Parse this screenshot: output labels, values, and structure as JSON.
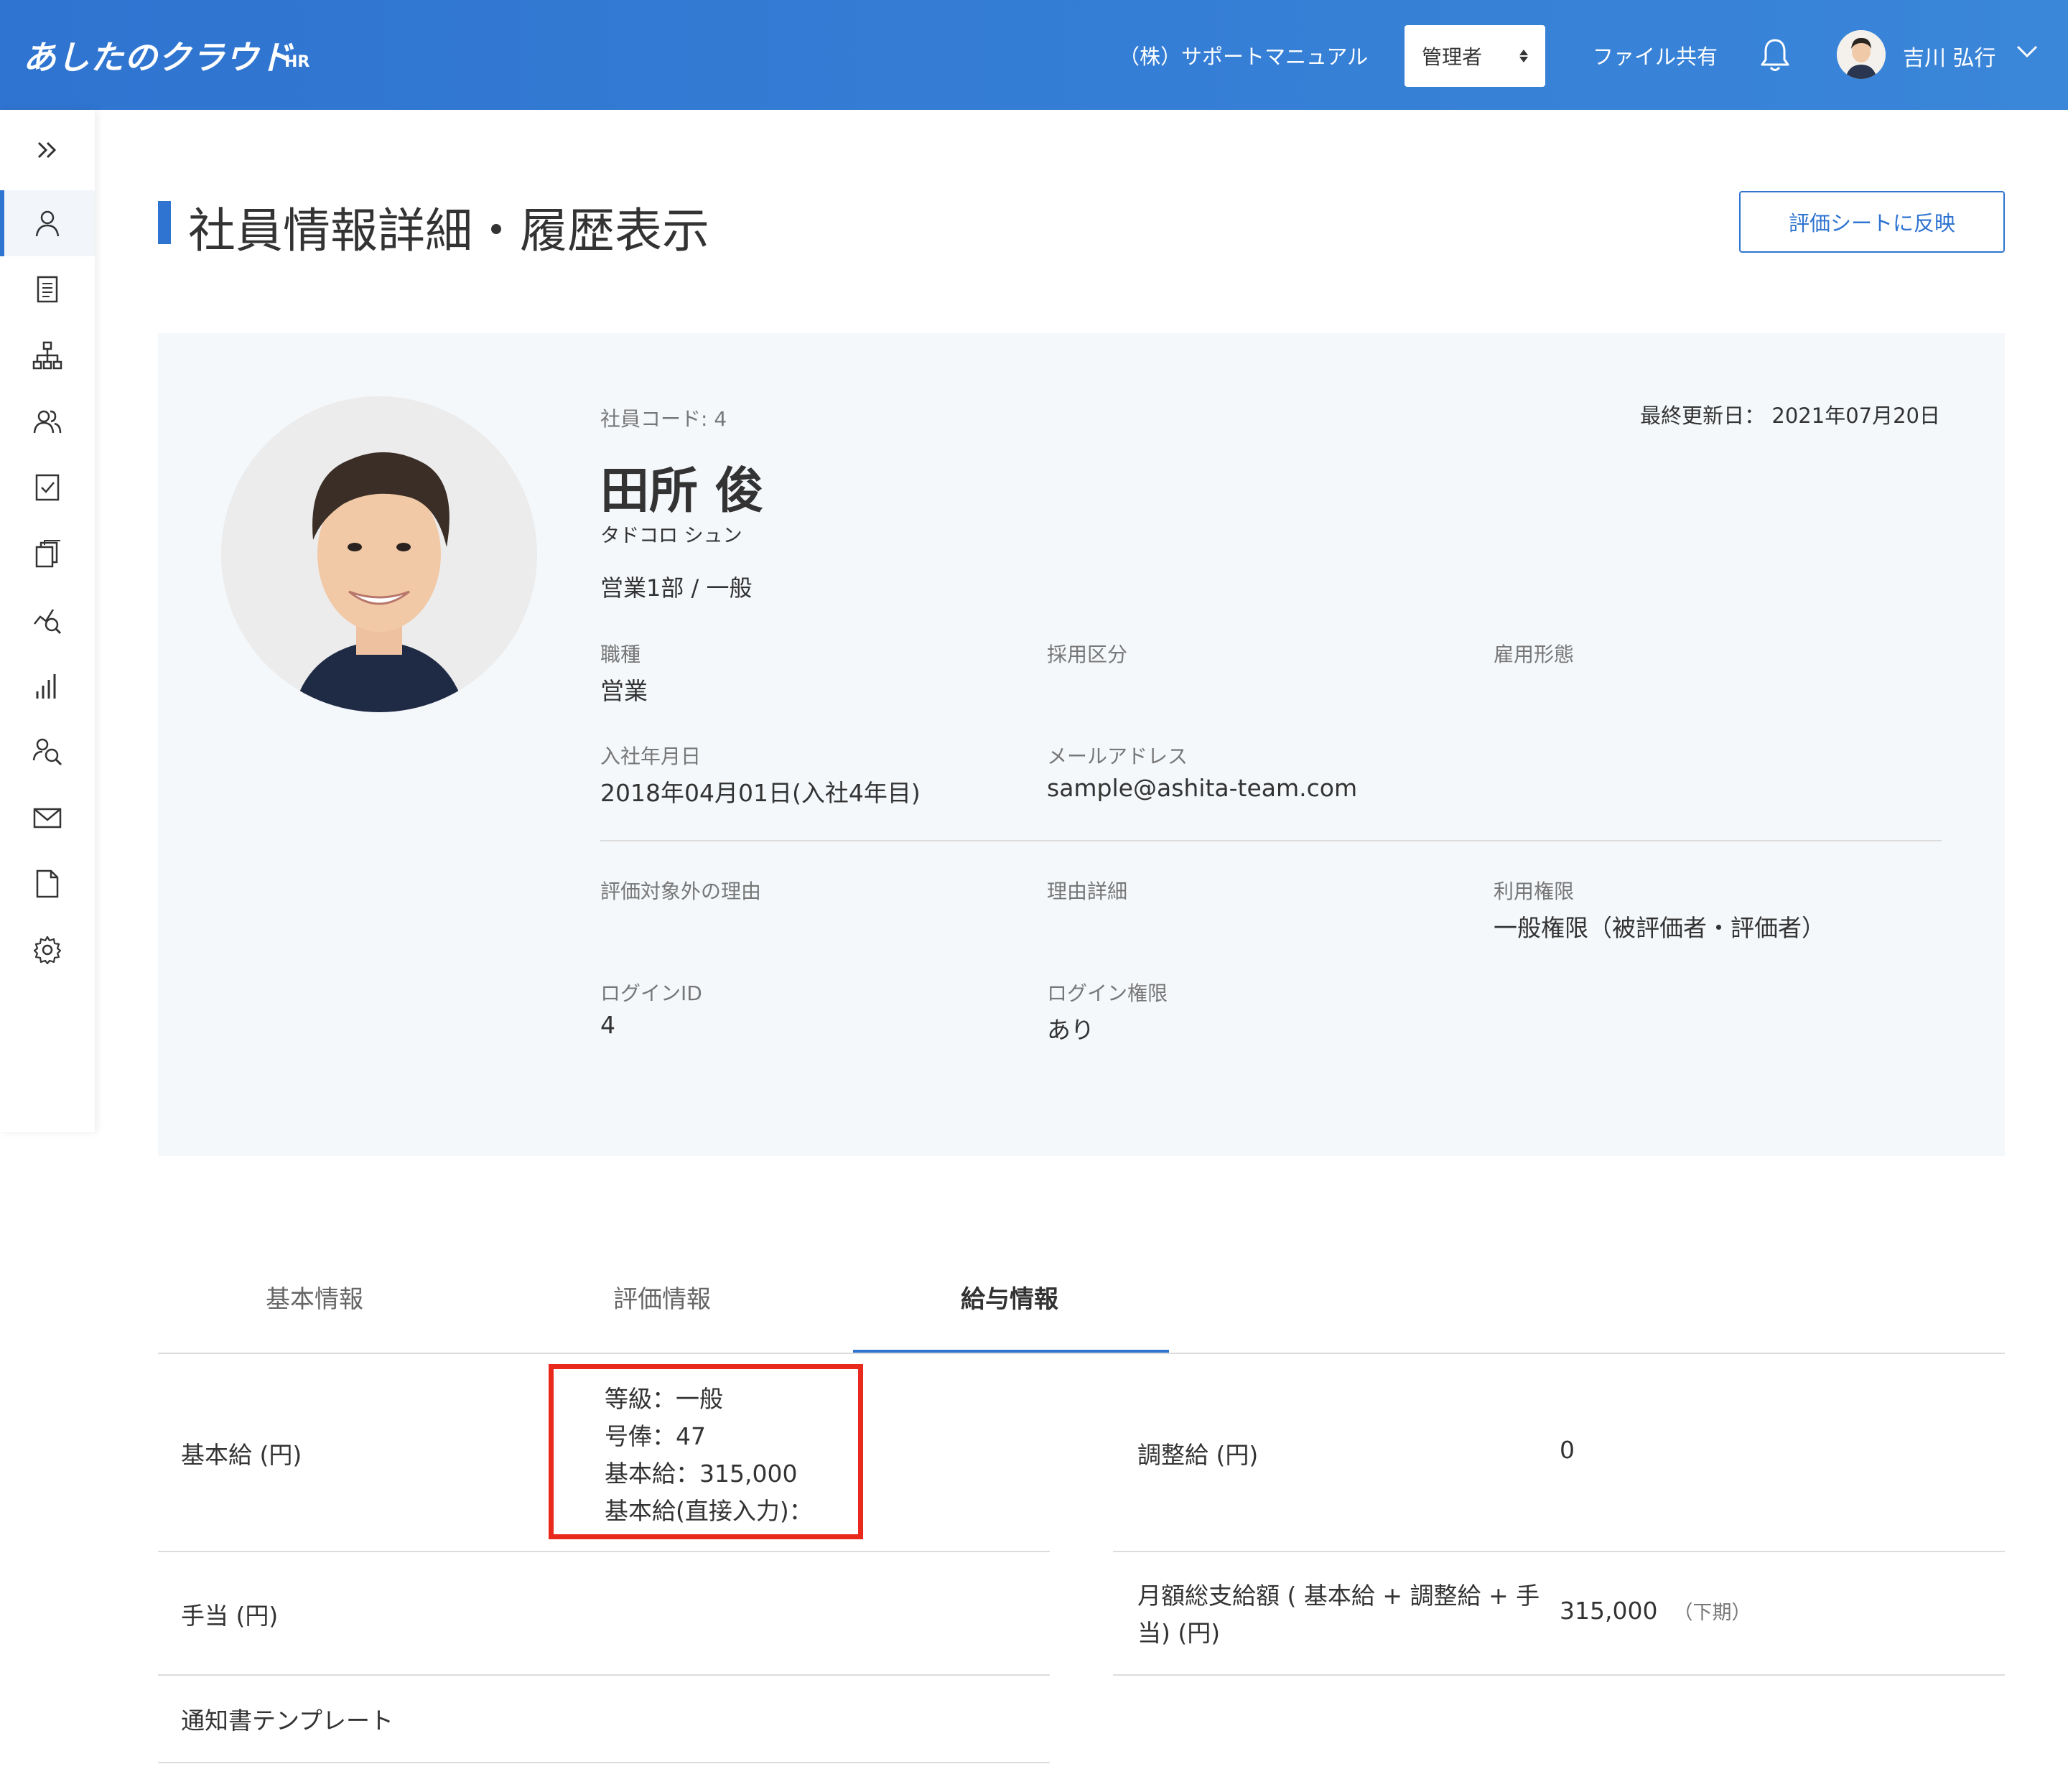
{
  "header": {
    "logo_text": "あしたのクラウド",
    "logo_sub": "HR",
    "company": "（株）サポートマニュアル",
    "role_selected": "管理者",
    "file_share": "ファイル共有",
    "user_name": "吉川 弘行",
    "brand_color": "#2f74d0"
  },
  "sidebar": {
    "items": [
      {
        "icon": "expand-icon"
      },
      {
        "icon": "person-icon"
      },
      {
        "icon": "document-icon"
      },
      {
        "icon": "org-chart-icon"
      },
      {
        "icon": "users-icon"
      },
      {
        "icon": "checklist-icon"
      },
      {
        "icon": "copy-icon"
      },
      {
        "icon": "analytics-icon"
      },
      {
        "icon": "bar-chart-icon"
      },
      {
        "icon": "person-search-icon"
      },
      {
        "icon": "mail-icon"
      },
      {
        "icon": "file-icon"
      },
      {
        "icon": "gear-icon"
      }
    ]
  },
  "page": {
    "title": "社員情報詳細・履歴表示",
    "reflect_button": "評価シートに反映"
  },
  "profile": {
    "employee_code": "社員コード: 4",
    "last_updated": "最終更新日： 2021年07月20日",
    "name": "田所 俊",
    "kana": "タドコロ シュン",
    "dept": "営業1部 / 一般",
    "fields": {
      "job_type_label": "職種",
      "job_type_value": "営業",
      "hiring_label": "採用区分",
      "hiring_value": "",
      "employment_label": "雇用形態",
      "employment_value": "",
      "join_date_label": "入社年月日",
      "join_date_value": "2018年04月01日(入社4年目)",
      "email_label": "メールアドレス",
      "email_value": "sample@ashita-team.com",
      "exclusion_label": "評価対象外の理由",
      "exclusion_value": "",
      "reason_label": "理由詳細",
      "reason_value": "",
      "permission_label": "利用権限",
      "permission_value": "一般権限（被評価者・評価者）",
      "login_id_label": "ログインID",
      "login_id_value": "4",
      "login_perm_label": "ログイン権限",
      "login_perm_value": "あり"
    }
  },
  "tabs": [
    {
      "label": "基本情報",
      "active": false
    },
    {
      "label": "評価情報",
      "active": false
    },
    {
      "label": "給与情報",
      "active": true
    }
  ],
  "salary": {
    "base_label": "基本給 (円)",
    "base_details": [
      "等級：一般",
      "号俸：47",
      "基本給：315,000",
      "基本給(直接入力)："
    ],
    "adjust_label": "調整給 (円)",
    "adjust_value": "0",
    "allowance_label": "手当 (円)",
    "monthly_label_line1": "月額総支給額 ( 基本給 + 調整給 + 手",
    "monthly_label_line2": "当) (円)",
    "monthly_value": "315,000",
    "monthly_period": "（下期）",
    "notice_label": "通知書テンプレート"
  }
}
